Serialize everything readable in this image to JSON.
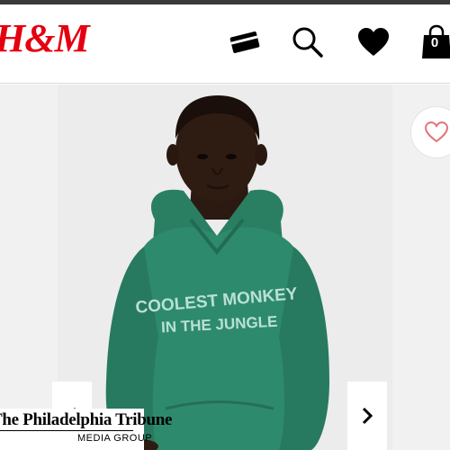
{
  "header": {
    "logo_text": "H&M",
    "brand_color": "#e50010",
    "icons": {
      "card": "card-icon",
      "search": "search-icon",
      "favorites": "heart-icon",
      "bag": "shopping-bag-icon"
    },
    "bag_count": "0"
  },
  "product": {
    "image": "product-photo",
    "hoodie_text_line1": "COOLEST MONKEY",
    "hoodie_text_line2": "IN THE JUNGLE",
    "favorite_icon": "heart-outline-icon",
    "prev_icon": "chevron-left-icon",
    "next_icon": "chevron-right-icon"
  },
  "watermark": {
    "title": "The Philadelphia Tribune",
    "subtitle": "MEDIA GROUP"
  },
  "colors": {
    "hoodie": "#2e8a6c",
    "heart_outline": "#e2757a",
    "top_bar": "#3a3a3a"
  }
}
